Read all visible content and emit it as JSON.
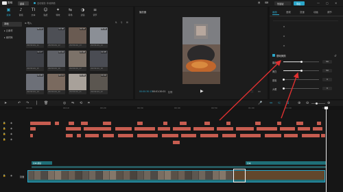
{
  "app": {
    "title": "剪映",
    "project_tag": "菜单",
    "status": "自动保存 本地草稿",
    "shortcut_label": "快捷键",
    "export_label": "导出",
    "window_controls": [
      "—",
      "▢",
      "✕"
    ]
  },
  "media": {
    "tabs": [
      {
        "icon": "media-icon",
        "glyph": "▣",
        "label": "媒体",
        "active": true
      },
      {
        "icon": "audio-icon",
        "glyph": "♪",
        "label": "音频",
        "active": false
      },
      {
        "icon": "text-icon",
        "glyph": "TI",
        "label": "文本",
        "active": false
      },
      {
        "icon": "sticker-icon",
        "glyph": "☺",
        "label": "贴纸",
        "active": false
      },
      {
        "icon": "effects-icon",
        "glyph": "✦",
        "label": "特效",
        "active": false
      },
      {
        "icon": "transition-icon",
        "glyph": "⇆",
        "label": "转场",
        "active": false
      },
      {
        "icon": "filter-icon",
        "glyph": "◑",
        "label": "滤镜",
        "active": false
      },
      {
        "icon": "adjust-icon",
        "glyph": "≡",
        "label": "调节",
        "active": false
      }
    ],
    "side_nav": [
      {
        "label": "本地",
        "active": true
      },
      {
        "label": "▸ 云素材",
        "active": false
      },
      {
        "label": "▸ 素材库",
        "active": false
      }
    ],
    "import_label": "导入",
    "toolbar_icons": [
      "sort-icon",
      "filter-icon",
      "grid-icon"
    ],
    "thumbs": [
      {
        "dur": "00:12",
        "name": "20230101_11",
        "color": "#6a6f78"
      },
      {
        "dur": "00:06",
        "name": "20230101_12",
        "color": "#4d4f55"
      },
      {
        "dur": "00:03",
        "name": "20230101_13",
        "color": "#6a5b52"
      },
      {
        "dur": "00:10",
        "name": "20230101_14",
        "color": "#8b8f96"
      },
      {
        "dur": "00:07",
        "name": "20230101_15",
        "color": "#3f4147"
      },
      {
        "dur": "00:04",
        "name": "20230101_16",
        "color": "#5e6066"
      },
      {
        "dur": "00:08",
        "name": "20230101_17",
        "color": "#7c7269"
      },
      {
        "dur": "00:05",
        "name": "20230101_18",
        "color": "#4a4c53"
      },
      {
        "dur": "00:09",
        "name": "20230101_19",
        "color": "#6d7078"
      },
      {
        "dur": "00:11",
        "name": "20230101_20",
        "color": "#7a6a5f"
      },
      {
        "dur": "00:06",
        "name": "20230101_21",
        "color": "#a8a19a"
      },
      {
        "dur": "00:04",
        "name": "20230101_22",
        "color": "#5b5650"
      }
    ]
  },
  "player": {
    "title": "播放器",
    "time_current": "00:00:30:13",
    "time_total": "00:01:20:01",
    "ratio": "比例"
  },
  "props": {
    "tabs": [
      {
        "label": "画面",
        "active": true
      },
      {
        "label": "音频",
        "active": false
      },
      {
        "label": "变速",
        "active": false
      },
      {
        "label": "动画",
        "active": false
      },
      {
        "label": "调节",
        "active": false
      }
    ],
    "section_title": "基础美颜",
    "sliders": [
      {
        "label": "磨皮",
        "value": "50",
        "fraction": 0.5
      },
      {
        "label": "美白",
        "value": "50",
        "fraction": 0.5
      },
      {
        "label": "瘦脸",
        "value": "0",
        "fraction": 0.0
      },
      {
        "label": "大眼",
        "value": "0",
        "fraction": 0.0
      }
    ]
  },
  "timeline": {
    "ruler": [
      "00:00",
      "00:10",
      "00:20",
      "00:30",
      "00:40",
      "00:50",
      "01:00",
      "01:10",
      "01:20"
    ],
    "main_track_label": "封面",
    "teal_labels": [
      "文本 朗读",
      "文本"
    ]
  },
  "colors": {
    "accent": "#2aa6c9",
    "clip_red": "#c75d50",
    "clip_teal": "#1f6f78",
    "annotation_arrow": "#e03030"
  }
}
